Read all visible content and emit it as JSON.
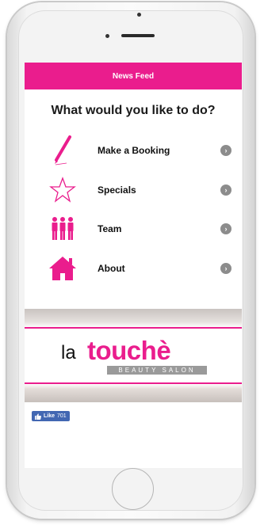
{
  "topbar": {
    "title": "News Feed"
  },
  "main": {
    "heading": "What would you like to do?",
    "menu": [
      {
        "label": "Make a Booking",
        "icon": "pencil-icon"
      },
      {
        "label": "Specials",
        "icon": "star-icon"
      },
      {
        "label": "Team",
        "icon": "team-icon"
      },
      {
        "label": "About",
        "icon": "home-icon"
      }
    ]
  },
  "banner": {
    "brand_la": "la",
    "brand_touche": "touchè",
    "brand_sub": "BEAUTY SALON"
  },
  "facebook": {
    "like_label": "Like",
    "like_count": "701"
  },
  "colors": {
    "accent": "#ea1d8d",
    "facebook": "#4267b2"
  }
}
